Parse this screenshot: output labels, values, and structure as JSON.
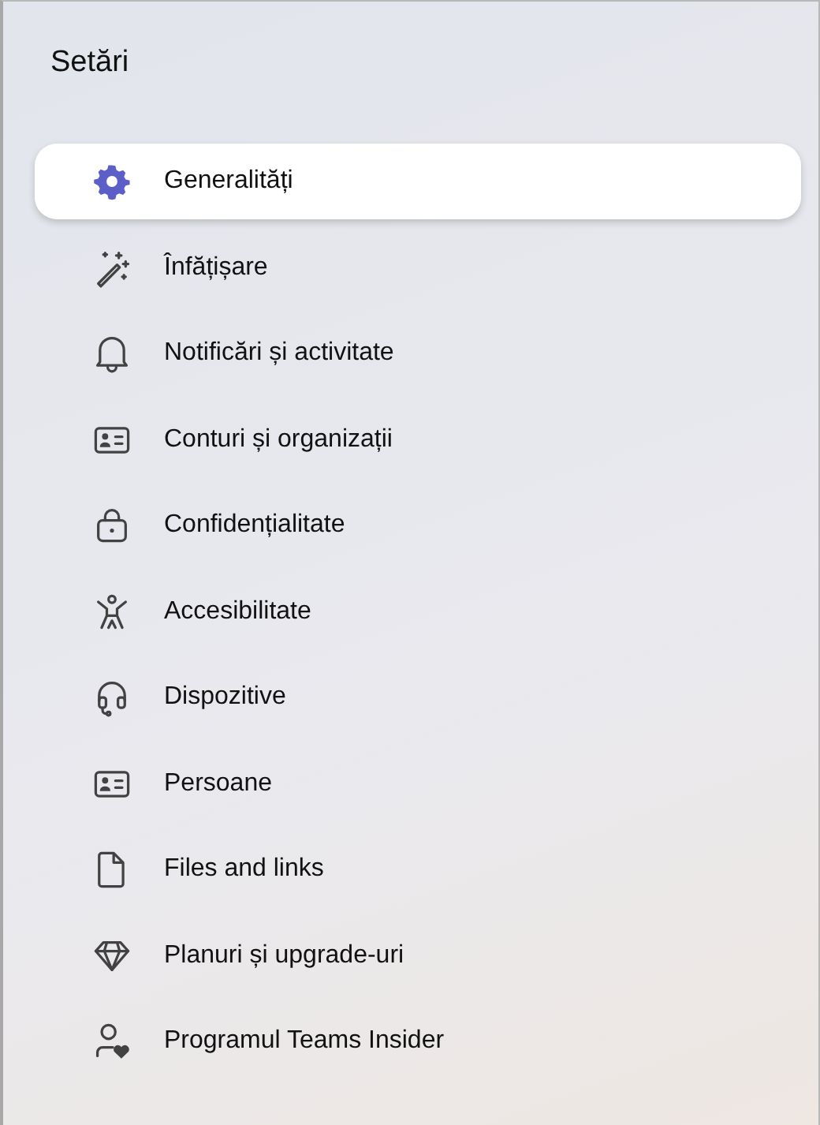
{
  "title": "Setări",
  "items": [
    {
      "label": "Generalități",
      "kind": "gear",
      "selected": true
    },
    {
      "label": "Înfățișare",
      "kind": "wand",
      "selected": false
    },
    {
      "label": "Notificări și activitate",
      "kind": "bell",
      "selected": false
    },
    {
      "label": "Conturi și organizații",
      "kind": "card",
      "selected": false
    },
    {
      "label": "Confidențialitate",
      "kind": "lock",
      "selected": false
    },
    {
      "label": "Accesibilitate",
      "kind": "person",
      "selected": false
    },
    {
      "label": "Dispozitive",
      "kind": "headset",
      "selected": false
    },
    {
      "label": "Persoane",
      "kind": "card",
      "selected": false
    },
    {
      "label": "Files and links",
      "kind": "file",
      "selected": false
    },
    {
      "label": "Planuri și upgrade-uri",
      "kind": "diamond",
      "selected": false
    },
    {
      "label": "Programul Teams Insider",
      "kind": "personheart",
      "selected": false
    }
  ]
}
